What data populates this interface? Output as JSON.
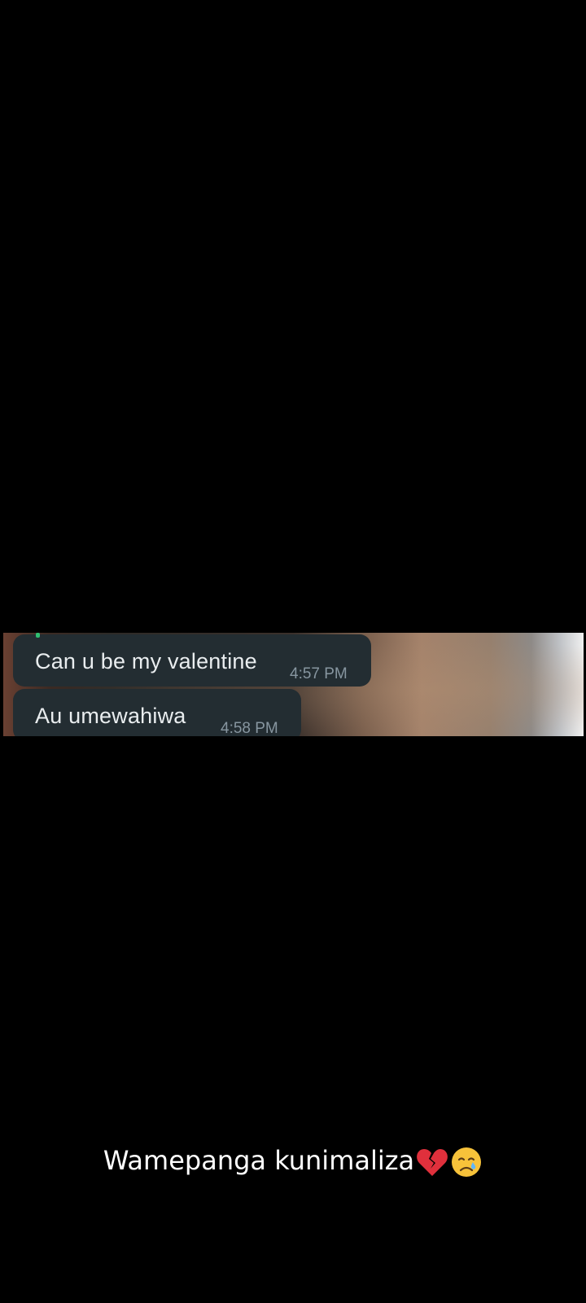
{
  "chat": {
    "messages": [
      {
        "text": "Can u be my valentine",
        "time": "4:57 PM"
      },
      {
        "text": "Au umewahiwa",
        "time": "4:58 PM"
      }
    ]
  },
  "caption": {
    "text": "Wamepanga kunimaliza",
    "emojis": [
      "broken-heart-icon",
      "crying-face-icon"
    ]
  }
}
